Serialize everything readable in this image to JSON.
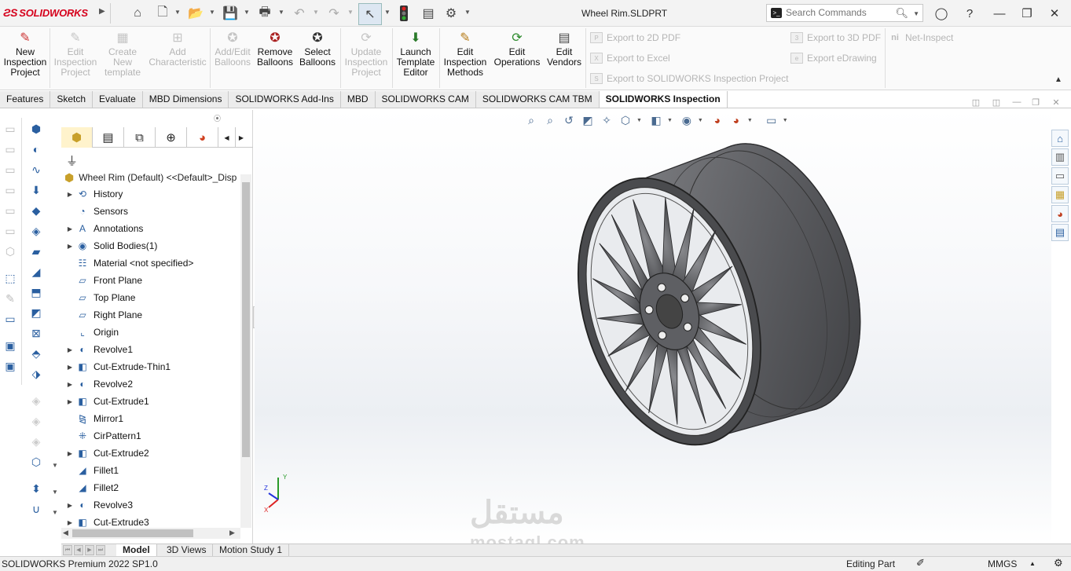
{
  "app": {
    "logo": "SOLIDWORKS",
    "document_title": "Wheel Rim.SLDPRT"
  },
  "quick_access": [
    "home-icon",
    "new-document-icon",
    "open-icon",
    "save-icon",
    "print-icon",
    "undo-icon",
    "redo-icon",
    "select-arrow-icon",
    "rebuild-traffic-light-icon",
    "file-properties-icon",
    "options-gear-icon"
  ],
  "search": {
    "placeholder": "Search Commands",
    "value": ""
  },
  "ribbon": {
    "buttons": [
      {
        "lines": [
          "New",
          "Inspection",
          "Project"
        ],
        "icon": "new-inspection-project-icon",
        "disabled": false
      },
      {
        "lines": [
          "Edit",
          "Inspection",
          "Project"
        ],
        "icon": "edit-inspection-project-icon",
        "disabled": true
      },
      {
        "lines": [
          "Create",
          "New",
          "template"
        ],
        "icon": "create-template-icon",
        "disabled": true
      },
      {
        "lines": [
          "Add",
          "Characteristic"
        ],
        "icon": "add-characteristic-icon",
        "disabled": true
      },
      {
        "lines": [
          "Add/Edit",
          "Balloons"
        ],
        "icon": "add-balloons-icon",
        "disabled": true
      },
      {
        "lines": [
          "Remove",
          "Balloons"
        ],
        "icon": "remove-balloons-icon",
        "disabled": false
      },
      {
        "lines": [
          "Select",
          "Balloons"
        ],
        "icon": "select-balloons-icon",
        "disabled": false
      },
      {
        "lines": [
          "Update",
          "Inspection",
          "Project"
        ],
        "icon": "update-project-icon",
        "disabled": true
      },
      {
        "lines": [
          "Launch",
          "Template",
          "Editor"
        ],
        "icon": "template-editor-icon",
        "disabled": false
      },
      {
        "lines": [
          "Edit",
          "Inspection",
          "Methods"
        ],
        "icon": "edit-methods-icon",
        "disabled": false
      },
      {
        "lines": [
          "Edit",
          "Operations"
        ],
        "icon": "edit-operations-icon",
        "disabled": false
      },
      {
        "lines": [
          "Edit",
          "Vendors"
        ],
        "icon": "edit-vendors-icon",
        "disabled": false
      }
    ],
    "exports_col1": [
      "Export to 2D PDF",
      "Export to Excel",
      "Export to SOLIDWORKS Inspection Project"
    ],
    "exports_col2": [
      "Export to 3D PDF",
      "Export eDrawing"
    ],
    "net_inspect": "Net-Inspect"
  },
  "command_tabs": [
    {
      "label": "Features",
      "active": false
    },
    {
      "label": "Sketch",
      "active": false
    },
    {
      "label": "Evaluate",
      "active": false
    },
    {
      "label": "MBD Dimensions",
      "active": false
    },
    {
      "label": "SOLIDWORKS Add-Ins",
      "active": false
    },
    {
      "label": "MBD",
      "active": false
    },
    {
      "label": "SOLIDWORKS CAM",
      "active": false
    },
    {
      "label": "SOLIDWORKS CAM TBM",
      "active": false
    },
    {
      "label": "SOLIDWORKS Inspection",
      "active": true
    }
  ],
  "feature_tree": {
    "root": "Wheel Rim (Default) <<Default>_Disp",
    "items": [
      {
        "label": "History",
        "expandable": true,
        "icon": "history-icon"
      },
      {
        "label": "Sensors",
        "expandable": false,
        "icon": "sensor-icon"
      },
      {
        "label": "Annotations",
        "expandable": true,
        "icon": "annotations-icon"
      },
      {
        "label": "Solid Bodies(1)",
        "expandable": true,
        "icon": "solid-bodies-icon"
      },
      {
        "label": "Material <not specified>",
        "expandable": false,
        "icon": "material-icon"
      },
      {
        "label": "Front Plane",
        "expandable": false,
        "icon": "plane-icon"
      },
      {
        "label": "Top Plane",
        "expandable": false,
        "icon": "plane-icon"
      },
      {
        "label": "Right Plane",
        "expandable": false,
        "icon": "plane-icon"
      },
      {
        "label": "Origin",
        "expandable": false,
        "icon": "origin-icon"
      },
      {
        "label": "Revolve1",
        "expandable": true,
        "icon": "revolve-icon"
      },
      {
        "label": "Cut-Extrude-Thin1",
        "expandable": true,
        "icon": "cut-extrude-icon"
      },
      {
        "label": "Revolve2",
        "expandable": true,
        "icon": "revolve-icon"
      },
      {
        "label": "Cut-Extrude1",
        "expandable": true,
        "icon": "cut-extrude-icon"
      },
      {
        "label": "Mirror1",
        "expandable": false,
        "icon": "mirror-icon"
      },
      {
        "label": "CirPattern1",
        "expandable": false,
        "icon": "circular-pattern-icon"
      },
      {
        "label": "Cut-Extrude2",
        "expandable": true,
        "icon": "cut-extrude-icon"
      },
      {
        "label": "Fillet1",
        "expandable": false,
        "icon": "fillet-icon"
      },
      {
        "label": "Fillet2",
        "expandable": false,
        "icon": "fillet-icon"
      },
      {
        "label": "Revolve3",
        "expandable": true,
        "icon": "revolve-icon"
      },
      {
        "label": "Cut-Extrude3",
        "expandable": true,
        "icon": "cut-extrude-icon"
      }
    ]
  },
  "bottom_tabs": [
    {
      "label": "Model",
      "active": true
    },
    {
      "label": "3D Views",
      "active": false
    },
    {
      "label": "Motion Study 1",
      "active": false
    }
  ],
  "status": {
    "product": "SOLIDWORKS Premium 2022 SP1.0",
    "mode": "Editing Part",
    "units": "MMGS"
  },
  "watermark": {
    "arabic": "مستقل",
    "latin": "mostaql.com"
  },
  "colors": {
    "brand_red": "#d6001c",
    "accent_blue": "#2a5fa0",
    "rim_gray": "#5a5a5c"
  }
}
